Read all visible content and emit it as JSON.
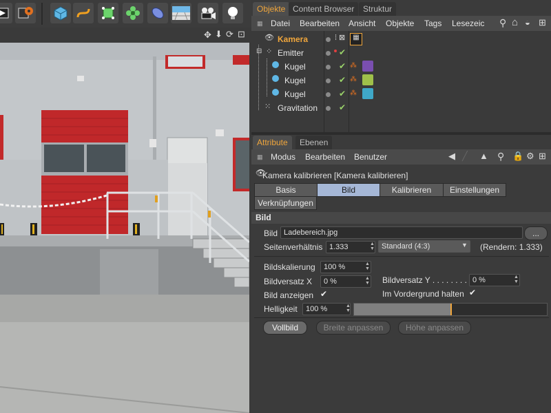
{
  "object_manager": {
    "tabs": [
      "Objekte",
      "Content Browser",
      "Struktur"
    ],
    "menu": [
      "Datei",
      "Bearbeiten",
      "Ansicht",
      "Objekte",
      "Tags",
      "Lesezeic"
    ],
    "objects": [
      {
        "name": "Kamera",
        "selected": true,
        "icon": "camera-icon"
      },
      {
        "name": "Emitter",
        "icon": "emitter-icon"
      },
      {
        "name": "Kugel",
        "icon": "sphere-icon"
      },
      {
        "name": "Kugel",
        "icon": "sphere-icon"
      },
      {
        "name": "Kugel",
        "icon": "sphere-icon"
      },
      {
        "name": "Gravitation",
        "icon": "gravity-icon"
      }
    ]
  },
  "attribute_manager": {
    "tabs": [
      "Attribute",
      "Ebenen"
    ],
    "menu": [
      "Modus",
      "Bearbeiten",
      "Benutzer"
    ],
    "title": "Kamera kalibrieren [Kamera kalibrieren]",
    "subtabs": [
      "Basis",
      "Bild",
      "Kalibrieren",
      "Einstellungen",
      "Verknüpfungen"
    ],
    "active_subtab": "Bild",
    "section": "Bild",
    "bild_label": "Bild",
    "bild_value": "Ladebereich.jpg",
    "browse_label": "...",
    "seitenverhaeltnis_label": "Seitenverhältnis",
    "seitenverhaeltnis_value": "1.333",
    "standard_value": "Standard (4:3)",
    "rendern_text": "(Rendern: 1.333)",
    "bildskalierung_label": "Bildskalierung",
    "bildskalierung_value": "100 %",
    "bildversatz_x_label": "Bildversatz X",
    "bildversatz_x_value": "0 %",
    "bildversatz_y_label": "Bildversatz Y . . . . . . . . .",
    "bildversatz_y_value": "0 %",
    "bild_anzeigen_label": "Bild anzeigen",
    "im_vordergrund_label": "Im Vordergrund halten",
    "helligkeit_label": "Helligkeit",
    "helligkeit_value": "100 %",
    "helligkeit_level": 1.0,
    "buttons": {
      "vollbild": "Vollbild",
      "breite": "Breite anpassen",
      "hoehe": "Höhe anpassen"
    }
  },
  "colors": {
    "accent": "#f0a63c",
    "active_tab": "#a5b7d6",
    "check": "#9ad36a"
  }
}
